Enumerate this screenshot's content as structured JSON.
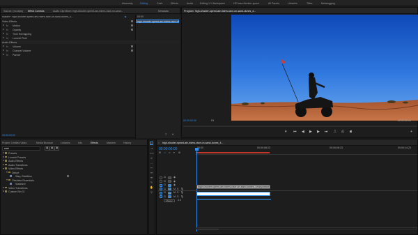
{
  "workspaces": [
    "Assembly",
    "Editing",
    "Color",
    "Effects",
    "Audio",
    "Editing 1.1 Workspace",
    "HP bass Monitor space",
    "All Panels",
    "Libraries",
    "Titles",
    "Metalogging"
  ],
  "active_workspace": "Editing",
  "source_panel": {
    "tabs": [
      "Source: (no clips)",
      "Effect Controls",
      "Audio Clip Mixer: high-shooter-speed-atv-riders-race-on-sand...",
      "Metadata"
    ],
    "clip_path": "Master * high-shooter-speed-atv-riders-race-on-sand-dunes_4..."
  },
  "mini_timeline": {
    "timecode": "00:00",
    "clip_label": "high-shooter-speed-atv-riders-race-on-sand-dunes_4..."
  },
  "effect_controls": {
    "video_header": "Video Effects",
    "video_items": [
      "Motion",
      "Opacity",
      "Time Remapping",
      "Lumetri Pixel"
    ],
    "audio_header": "Audio Effects",
    "audio_items": [
      "Volume",
      "Channel Volume",
      "Panner"
    ],
    "timecode": "00;00;00;00"
  },
  "program_panel": {
    "title": "Program: high-shooter-speed-atv-riders-race-on-sand-dunes_4...",
    "timecode": "00:00:00:00",
    "fit": "Fit",
    "duration": "00:00:00:00"
  },
  "project_panel": {
    "tabs": [
      "Project: Untitled Video",
      "Media Browser",
      "Libraries",
      "Info",
      "Effects",
      "Markers",
      "History"
    ],
    "active_tab": "Effects",
    "search_value": "stab",
    "tree": [
      {
        "label": "Presets",
        "level": 0
      },
      {
        "label": "Lumetri Presets",
        "level": 0
      },
      {
        "label": "Audio Effects",
        "level": 0
      },
      {
        "label": "Audio Transitions",
        "level": 0
      },
      {
        "label": "Video Effects",
        "level": 0
      },
      {
        "label": "Distort",
        "level": 1
      },
      {
        "label": "Warp Stabilizer",
        "level": 2
      },
      {
        "label": "Obsolete Essentials",
        "level": 1
      },
      {
        "label": "Stabilizer",
        "level": 2
      },
      {
        "label": "Video Transitions",
        "level": 0
      },
      {
        "label": "Custom Bin 01",
        "level": 0
      }
    ]
  },
  "timeline": {
    "tab": "high-shooter-speed-atv-riders-race-on-sand-dunes_4...",
    "timecode": "00:00:00:00",
    "ruler_ticks": [
      "00:00",
      "00:00:08:23",
      "00:00:08:23",
      "00:00:14:23"
    ],
    "tracks": [
      "V3",
      "V2",
      "V1",
      "A1",
      "A2",
      "A3",
      "Master"
    ],
    "master_value": "0.0",
    "video_clip_label": "high-shooter-speed-atv-riders-race-on-sand-dunes_4/tokyowave",
    "audio_clip_label": ""
  },
  "colors": {
    "accent": "#2d8ceb",
    "clip_video": "#b3b3b3",
    "clip_audio": "#8fb6e0"
  }
}
